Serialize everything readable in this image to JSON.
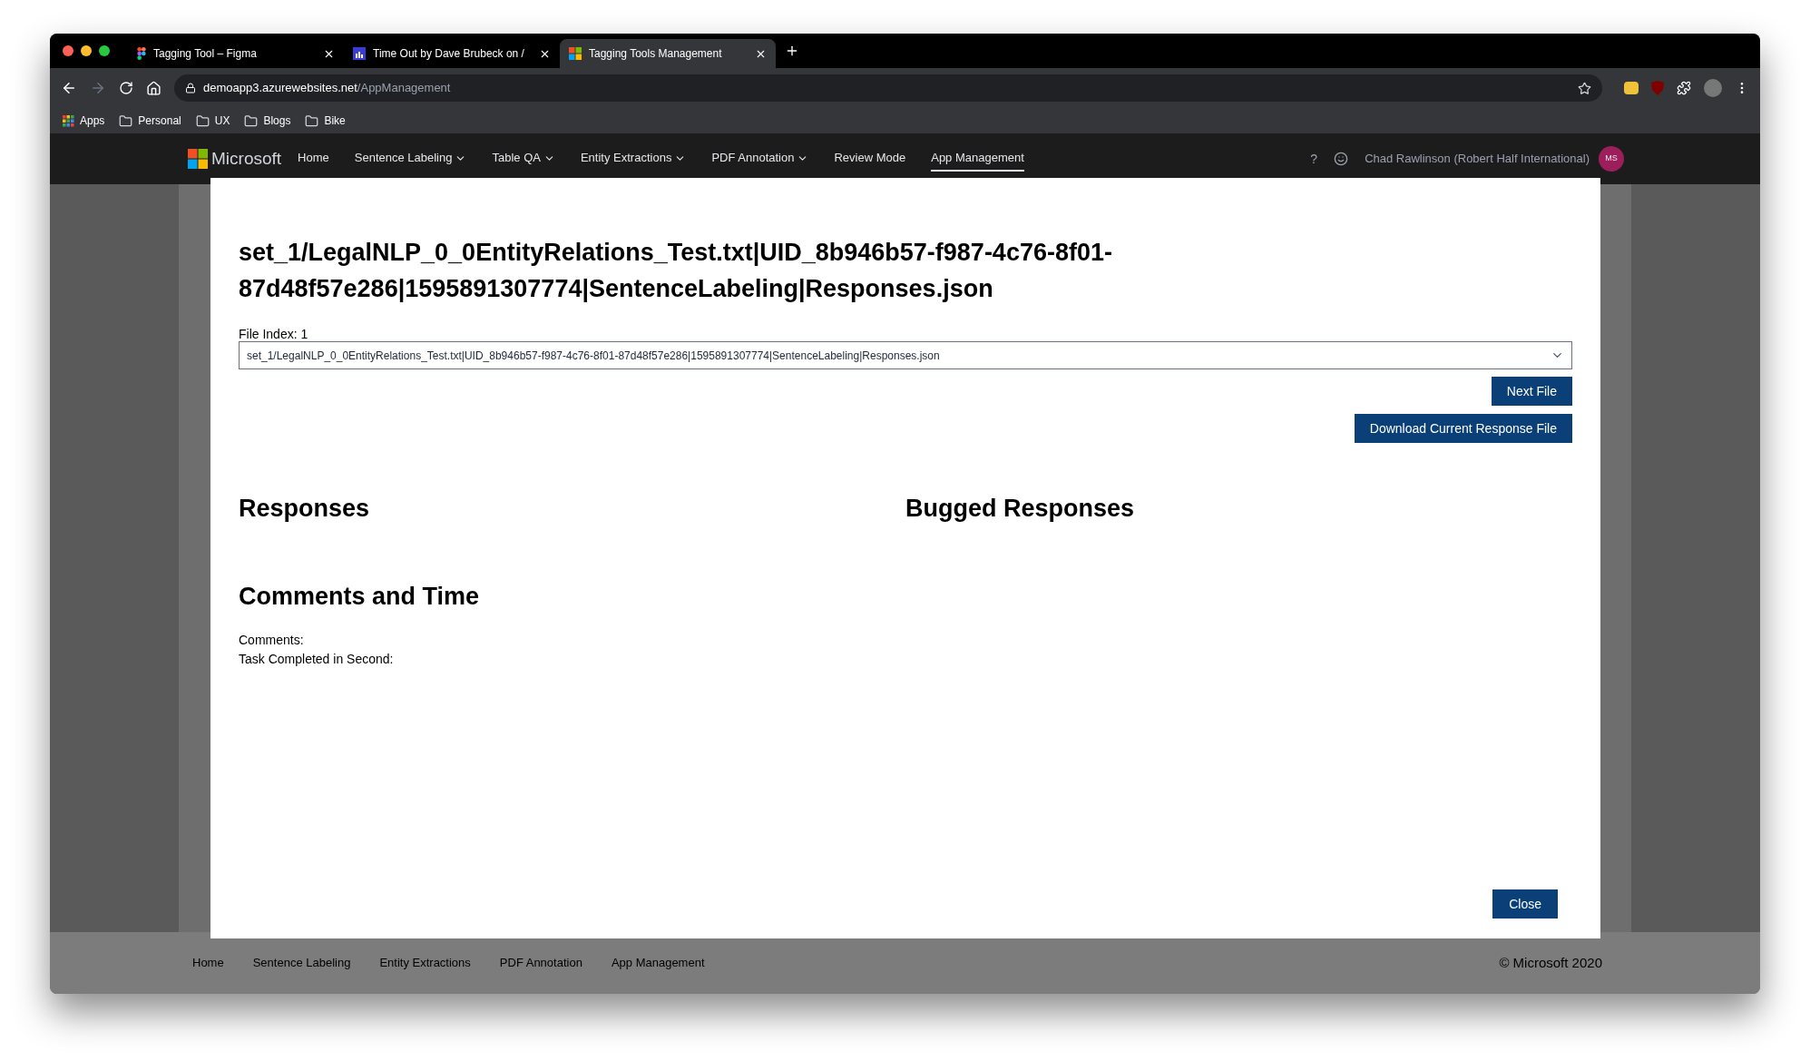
{
  "browser": {
    "tabs": [
      {
        "title": "Tagging Tool – Figma",
        "kind": "figma",
        "selected": false
      },
      {
        "title": "Time Out by Dave Brubeck on /",
        "kind": "music",
        "selected": false
      },
      {
        "title": "Tagging Tools Management",
        "kind": "microsoft",
        "selected": true
      }
    ],
    "address": {
      "domain": "demoapp3.azurewebsites.net",
      "path": "/AppManagement"
    },
    "bookmarks": [
      {
        "label": "Apps",
        "kind": "apps"
      },
      {
        "label": "Personal",
        "kind": "folder"
      },
      {
        "label": "UX",
        "kind": "folder"
      },
      {
        "label": "Blogs",
        "kind": "folder"
      },
      {
        "label": "Bike",
        "kind": "folder"
      }
    ]
  },
  "nav": {
    "brand": "Microsoft",
    "items": [
      {
        "label": "Home",
        "dropdown": false,
        "selected": false
      },
      {
        "label": "Sentence Labeling",
        "dropdown": true,
        "selected": false
      },
      {
        "label": "Table QA",
        "dropdown": true,
        "selected": false
      },
      {
        "label": "Entity Extractions",
        "dropdown": true,
        "selected": false
      },
      {
        "label": "PDF Annotation",
        "dropdown": true,
        "selected": false
      },
      {
        "label": "Review Mode",
        "dropdown": false,
        "selected": false
      },
      {
        "label": "App Management",
        "dropdown": false,
        "selected": true
      }
    ],
    "help": "?",
    "user": "Chad Rawlinson (Robert Half International)",
    "avatar": "MS"
  },
  "modal": {
    "title": "set_1/LegalNLP_0_0EntityRelations_Test.txt|UID_8b946b57-f987-4c76-8f01-87d48f57e286|1595891307774|SentenceLabeling|Responses.json",
    "file_index_label": "File Index: 1",
    "file_select": "set_1/LegalNLP_0_0EntityRelations_Test.txt|UID_8b946b57-f987-4c76-8f01-87d48f57e286|1595891307774|SentenceLabeling|Responses.json",
    "next_button": "Next File",
    "download_button": "Download Current Response File",
    "responses_heading": "Responses",
    "bugged_heading": "Bugged Responses",
    "comments_heading": "Comments and Time",
    "fields": [
      "Comments:",
      "Task Completed in Second:"
    ],
    "close_button": "Close"
  },
  "footer": {
    "links": [
      "Home",
      "Sentence Labeling",
      "Entity Extractions",
      "PDF Annotation",
      "App Management"
    ],
    "copyright": "© Microsoft 2020"
  }
}
